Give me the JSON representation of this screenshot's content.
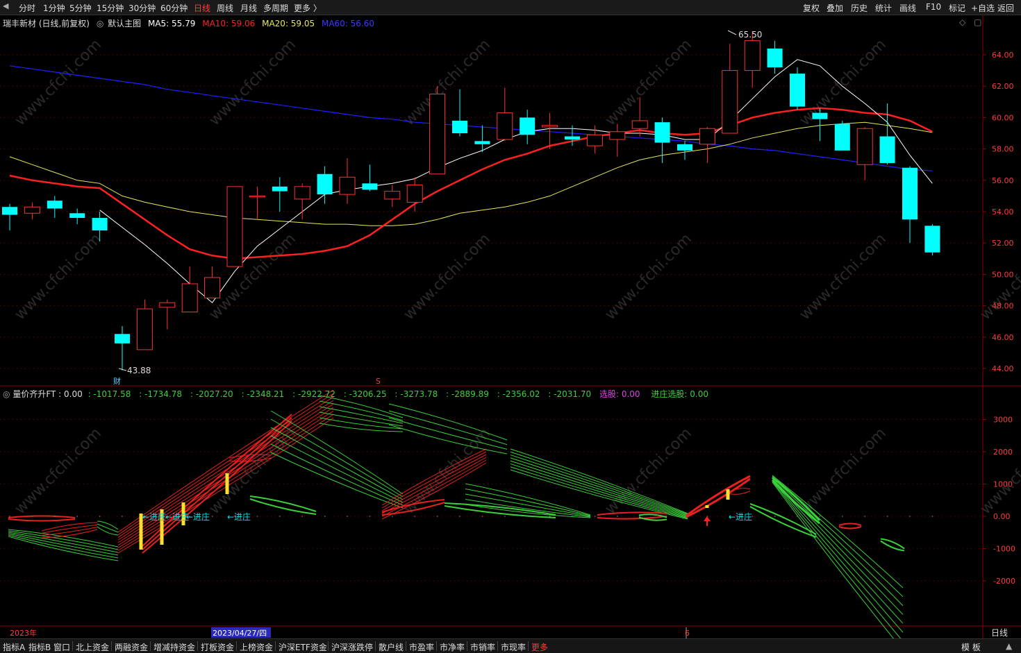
{
  "toolbar": {
    "periods": [
      "分时",
      "1分钟",
      "5分钟",
      "15分钟",
      "30分钟",
      "60分钟",
      "日线",
      "周线",
      "月线",
      "多周期",
      "更多 〉"
    ],
    "active_period": "日线",
    "right_buttons": [
      "复权",
      "叠加",
      "历史",
      "统计",
      "画线",
      "F10",
      "标记",
      "+自选",
      "返回"
    ]
  },
  "main_header": {
    "title": "瑞丰新材 (日线,前复权)",
    "template": "默认主图",
    "ma5": "MA5: 55.79",
    "ma10": "MA10: 59.06",
    "ma20": "MA20: 59.05",
    "ma60": "MA60: 56.60"
  },
  "sub_header": {
    "name": "量价齐升FT",
    "values": [
      ": 0.00",
      ": -1017.58",
      ": -1734.78",
      ": -2027.20",
      ": -2348.21",
      ": -2922.72",
      ": -3206.25",
      ": -3273.78",
      ": -2889.89",
      ": -2356.02",
      ": -2031.70"
    ],
    "xuangu": "选股: 0.00",
    "jinzhuang_xuangu": "进庄选股: 0.00"
  },
  "price_axis": [
    "64.00",
    "62.00",
    "60.00",
    "58.00",
    "56.00",
    "54.00",
    "52.00",
    "50.00",
    "48.00",
    "46.00",
    "44.00"
  ],
  "indicator_axis": [
    "3000",
    "2000",
    "1000",
    "0.00",
    "-1000",
    "-2000"
  ],
  "markers": {
    "high": "65.50",
    "low": "43.88",
    "cai": "财",
    "s_mark": "S",
    "jinzhuang": "←进庄",
    "bottom_mark_6": "6"
  },
  "time_axis": {
    "year": "2023年",
    "date": "2023/04/27/四",
    "period_label": "日线"
  },
  "bottom_tabs": [
    "指标A",
    "指标B",
    "窗口",
    "北上资金",
    "两融资金",
    "增减持资金",
    "打板资金",
    "上榜资金",
    "沪深ETF资金",
    "沪深涨跌停",
    "散户线",
    "市盈率",
    "市净率",
    "市销率",
    "市现率",
    "更多"
  ],
  "bottom_right": [
    "模 板",
    "▲"
  ],
  "watermark": "www.cfchi.com",
  "colors": {
    "up": "#ff3232",
    "down": "#00ffff",
    "ma5": "#ffffff",
    "ma10": "#ff2020",
    "ma20": "#e8e85a",
    "ma60": "#2020ff",
    "grid": "#8b0000"
  },
  "chart_data": {
    "type": "candlestick",
    "price_range": [
      43,
      66
    ],
    "candles": [
      {
        "o": 54.3,
        "h": 54.5,
        "l": 52.8,
        "c": 53.8
      },
      {
        "o": 53.9,
        "h": 54.6,
        "l": 53.5,
        "c": 54.3
      },
      {
        "o": 54.7,
        "h": 55.0,
        "l": 53.6,
        "c": 54.2
      },
      {
        "o": 53.9,
        "h": 54.2,
        "l": 53.2,
        "c": 53.6
      },
      {
        "o": 53.6,
        "h": 54.0,
        "l": 52.1,
        "c": 52.8
      },
      {
        "o": 46.2,
        "h": 46.7,
        "l": 43.88,
        "c": 45.6
      },
      {
        "o": 45.2,
        "h": 48.4,
        "l": 45.2,
        "c": 47.8
      },
      {
        "o": 47.9,
        "h": 48.4,
        "l": 46.5,
        "c": 48.2
      },
      {
        "o": 47.6,
        "h": 50.5,
        "l": 47.6,
        "c": 49.4
      },
      {
        "o": 48.5,
        "h": 50.5,
        "l": 48.5,
        "c": 49.8
      },
      {
        "o": 50.5,
        "h": 55.6,
        "l": 50.5,
        "c": 55.6
      },
      {
        "o": 55.0,
        "h": 55.6,
        "l": 53.5,
        "c": 55.0
      },
      {
        "o": 55.6,
        "h": 56.2,
        "l": 54.0,
        "c": 55.3
      },
      {
        "o": 54.8,
        "h": 55.8,
        "l": 53.5,
        "c": 55.6
      },
      {
        "o": 56.4,
        "h": 56.9,
        "l": 54.5,
        "c": 55.1
      },
      {
        "o": 55.1,
        "h": 57.4,
        "l": 54.5,
        "c": 56.2
      },
      {
        "o": 55.8,
        "h": 57.0,
        "l": 55.3,
        "c": 55.4
      },
      {
        "o": 54.8,
        "h": 55.7,
        "l": 54.3,
        "c": 55.3
      },
      {
        "o": 54.6,
        "h": 56.2,
        "l": 54.0,
        "c": 55.7
      },
      {
        "o": 56.4,
        "h": 62.0,
        "l": 56.4,
        "c": 61.5
      },
      {
        "o": 59.8,
        "h": 61.8,
        "l": 58.8,
        "c": 59.0
      },
      {
        "o": 58.5,
        "h": 59.5,
        "l": 57.8,
        "c": 58.3
      },
      {
        "o": 58.6,
        "h": 61.9,
        "l": 58.5,
        "c": 60.3
      },
      {
        "o": 60.0,
        "h": 60.5,
        "l": 58.3,
        "c": 58.9
      },
      {
        "o": 59.4,
        "h": 60.3,
        "l": 58.0,
        "c": 59.5
      },
      {
        "o": 58.8,
        "h": 59.5,
        "l": 58.2,
        "c": 58.6
      },
      {
        "o": 58.2,
        "h": 59.5,
        "l": 57.7,
        "c": 58.9
      },
      {
        "o": 58.6,
        "h": 59.6,
        "l": 57.5,
        "c": 59.1
      },
      {
        "o": 59.3,
        "h": 61.3,
        "l": 58.8,
        "c": 59.8
      },
      {
        "o": 59.7,
        "h": 60.0,
        "l": 57.1,
        "c": 58.4
      },
      {
        "o": 58.3,
        "h": 58.5,
        "l": 57.3,
        "c": 57.9
      },
      {
        "o": 58.3,
        "h": 59.4,
        "l": 57.1,
        "c": 59.3
      },
      {
        "o": 59.0,
        "h": 64.7,
        "l": 59.0,
        "c": 63.0
      },
      {
        "o": 63.0,
        "h": 65.5,
        "l": 61.9,
        "c": 64.9
      },
      {
        "o": 64.4,
        "h": 64.9,
        "l": 62.8,
        "c": 63.2
      },
      {
        "o": 62.8,
        "h": 63.2,
        "l": 60.5,
        "c": 60.7
      },
      {
        "o": 60.3,
        "h": 60.6,
        "l": 58.5,
        "c": 59.9
      },
      {
        "o": 59.6,
        "h": 59.8,
        "l": 57.9,
        "c": 57.9
      },
      {
        "o": 57.0,
        "h": 59.4,
        "l": 56.0,
        "c": 59.3
      },
      {
        "o": 58.8,
        "h": 60.9,
        "l": 57.0,
        "c": 57.1
      },
      {
        "o": 56.8,
        "h": 56.9,
        "l": 52.0,
        "c": 53.5
      },
      {
        "o": 53.1,
        "h": 53.2,
        "l": 51.2,
        "c": 51.4
      }
    ],
    "ma5": [
      null,
      null,
      null,
      null,
      54.1,
      53.0,
      51.9,
      50.7,
      49.4,
      48.2,
      50.2,
      51.8,
      52.9,
      54.0,
      55.1,
      55.4,
      55.6,
      55.8,
      56.1,
      56.8,
      57.4,
      57.9,
      58.6,
      59.1,
      59.3,
      59.3,
      59.2,
      59.0,
      59.0,
      58.9,
      58.6,
      58.6,
      59.8,
      61.2,
      62.6,
      63.7,
      63.3,
      62.0,
      60.9,
      59.7,
      57.6,
      55.8
    ],
    "ma10": [
      56.3,
      56.0,
      55.8,
      55.6,
      55.5,
      54.5,
      53.5,
      52.5,
      51.6,
      51.2,
      51.0,
      51.1,
      51.2,
      51.3,
      51.5,
      51.8,
      52.5,
      53.5,
      54.5,
      55.3,
      56.0,
      56.7,
      57.3,
      57.7,
      58.2,
      58.5,
      58.8,
      59.0,
      59.2,
      59.0,
      58.9,
      59.0,
      59.5,
      60.0,
      60.3,
      60.5,
      60.6,
      60.5,
      60.3,
      60.2,
      59.8,
      59.1
    ],
    "ma20": [
      57.5,
      57.0,
      56.5,
      56.0,
      55.8,
      55.0,
      54.6,
      54.3,
      54.0,
      53.8,
      53.6,
      53.5,
      53.4,
      53.3,
      53.2,
      53.2,
      53.1,
      53.1,
      53.2,
      53.5,
      53.9,
      54.1,
      54.3,
      54.6,
      55.0,
      55.6,
      56.2,
      56.8,
      57.3,
      57.6,
      57.8,
      58.0,
      58.3,
      58.7,
      59.0,
      59.3,
      59.5,
      59.6,
      59.7,
      59.5,
      59.3,
      59.05
    ],
    "ma60": [
      63.3,
      63.1,
      62.9,
      62.7,
      62.5,
      62.3,
      62.1,
      61.8,
      61.6,
      61.4,
      61.2,
      61.0,
      60.8,
      60.6,
      60.4,
      60.2,
      60.0,
      59.9,
      59.7,
      59.6,
      59.5,
      59.4,
      59.3,
      59.2,
      59.1,
      59.0,
      58.9,
      58.8,
      58.7,
      58.6,
      58.5,
      58.3,
      58.2,
      58.0,
      57.9,
      57.7,
      57.5,
      57.3,
      57.1,
      56.9,
      56.7,
      56.6
    ]
  }
}
